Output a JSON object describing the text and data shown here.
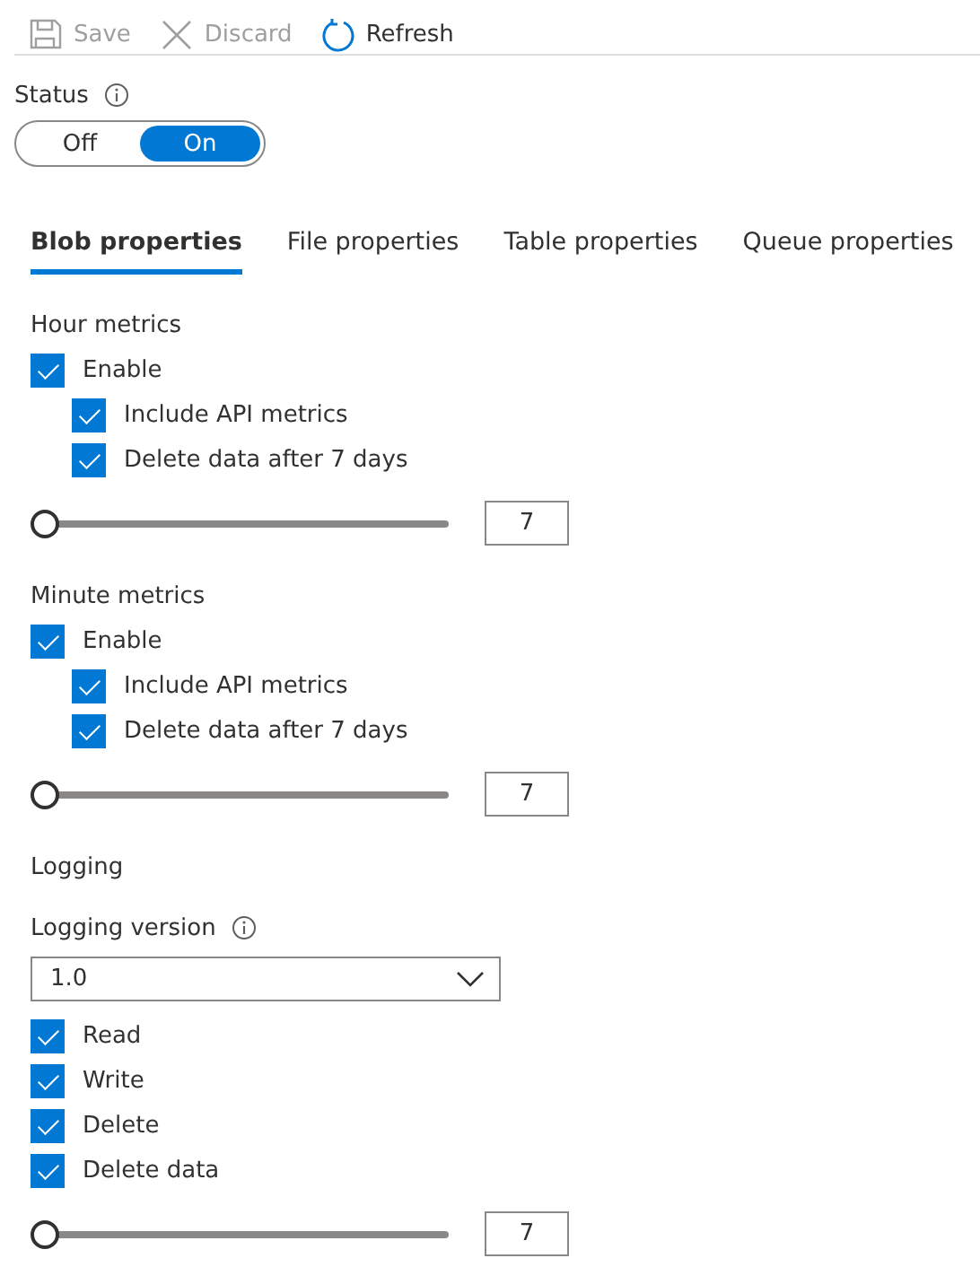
{
  "toolbar": [
    {
      "label": "Save",
      "disabled": true
    },
    {
      "label": "Discard",
      "disabled": true
    },
    {
      "label": "Refresh",
      "disabled": false
    }
  ],
  "status": {
    "label": "Status",
    "options": [
      {
        "label": "Off",
        "selected": false
      },
      {
        "label": "On",
        "selected": true
      }
    ]
  },
  "tabs": [
    {
      "label": "Blob properties",
      "selected": true
    },
    {
      "label": "File properties",
      "selected": false
    },
    {
      "label": "Table properties",
      "selected": false
    },
    {
      "label": "Queue properties",
      "selected": false
    }
  ],
  "sections": [
    {
      "kind": "metrics",
      "title": "Hour metrics",
      "checks": [
        {
          "label": "Enable",
          "checked": true,
          "children": [
            {
              "label": "Include API metrics",
              "checked": true
            },
            {
              "label": "Delete data after 7 days",
              "checked": true
            }
          ]
        }
      ],
      "slider": {
        "level": 0,
        "value": "7"
      }
    },
    {
      "kind": "metrics",
      "title": "Minute metrics",
      "checks": [
        {
          "label": "Enable",
          "checked": true,
          "children": [
            {
              "label": "Include API metrics",
              "checked": true
            },
            {
              "label": "Delete data after 7 days",
              "checked": true
            }
          ]
        }
      ],
      "slider": {
        "level": 0,
        "value": "7"
      }
    },
    {
      "kind": "logging",
      "title": "Logging",
      "version": {
        "label": "Logging version",
        "value": "1.0"
      },
      "checks": [
        {
          "label": "Read",
          "checked": true
        },
        {
          "label": "Write",
          "checked": true
        },
        {
          "label": "Delete",
          "checked": true
        },
        {
          "label": "Delete data",
          "checked": true
        }
      ],
      "slider": {
        "level": 0,
        "value": "7"
      }
    }
  ]
}
